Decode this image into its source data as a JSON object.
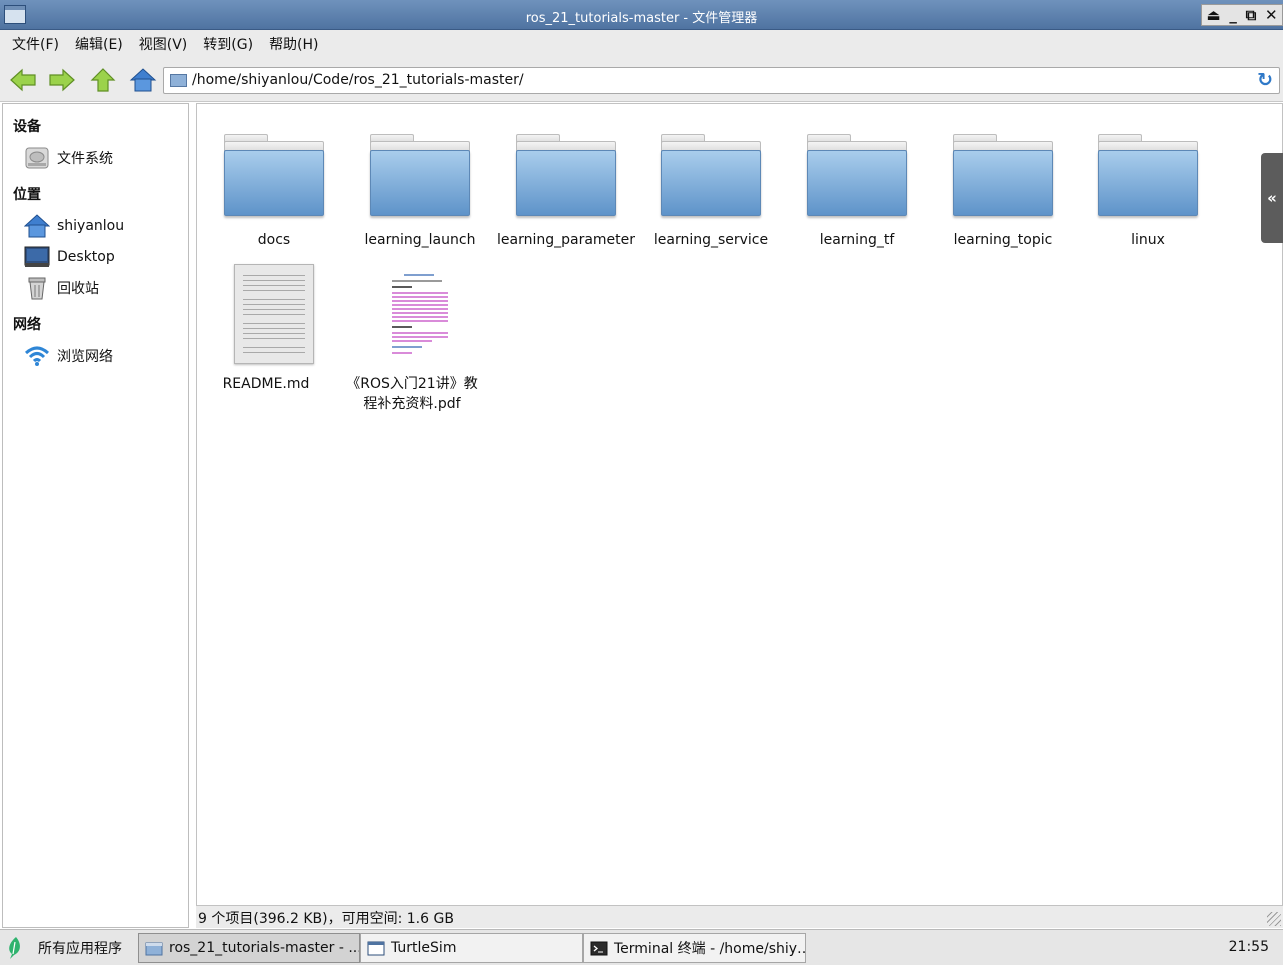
{
  "window": {
    "title": "ros_21_tutorials-master - 文件管理器"
  },
  "menu": [
    "文件(F)",
    "编辑(E)",
    "视图(V)",
    "转到(G)",
    "帮助(H)"
  ],
  "address": {
    "path": "/home/shiyanlou/Code/ros_21_tutorials-master/"
  },
  "sidebar": {
    "devices_header": "设备",
    "devices": [
      {
        "label": "文件系统",
        "icon": "harddisk-icon"
      }
    ],
    "places_header": "位置",
    "places": [
      {
        "label": "shiyanlou",
        "icon": "home-icon"
      },
      {
        "label": "Desktop",
        "icon": "desktop-icon"
      },
      {
        "label": "回收站",
        "icon": "trash-icon"
      }
    ],
    "network_header": "网络",
    "network": [
      {
        "label": "浏览网络",
        "icon": "wifi-icon"
      }
    ]
  },
  "files": [
    {
      "name": "docs",
      "type": "folder"
    },
    {
      "name": "learning_launch",
      "type": "folder"
    },
    {
      "name": "learning_parameter",
      "type": "folder"
    },
    {
      "name": "learning_service",
      "type": "folder"
    },
    {
      "name": "learning_tf",
      "type": "folder"
    },
    {
      "name": "learning_topic",
      "type": "folder"
    },
    {
      "name": "linux",
      "type": "folder"
    },
    {
      "name": "README.md",
      "type": "text-file"
    },
    {
      "name_line1": "《ROS入门21讲》教",
      "name_line2": "程补充资料.pdf",
      "type": "pdf-file"
    }
  ],
  "side_panel_toggle": "«",
  "status": "9 个项目(396.2 KB)，可用空间: 1.6 GB",
  "taskbar": {
    "start_label": "所有应用程序",
    "tasks": [
      {
        "label": "ros_21_tutorials-master - ...",
        "icon": "folder-icon",
        "active": true
      },
      {
        "label": "TurtleSim",
        "icon": "window-icon",
        "active": false
      },
      {
        "label": "Terminal 终端 - /home/shiy…",
        "icon": "terminal-icon",
        "active": false
      }
    ],
    "clock": "21:55"
  },
  "colors": {
    "titlebar": "#5b7eab",
    "folder": "#7aa9d8",
    "arrows": "#8ac43f",
    "taskbar_leaf": "#2fb36e"
  }
}
